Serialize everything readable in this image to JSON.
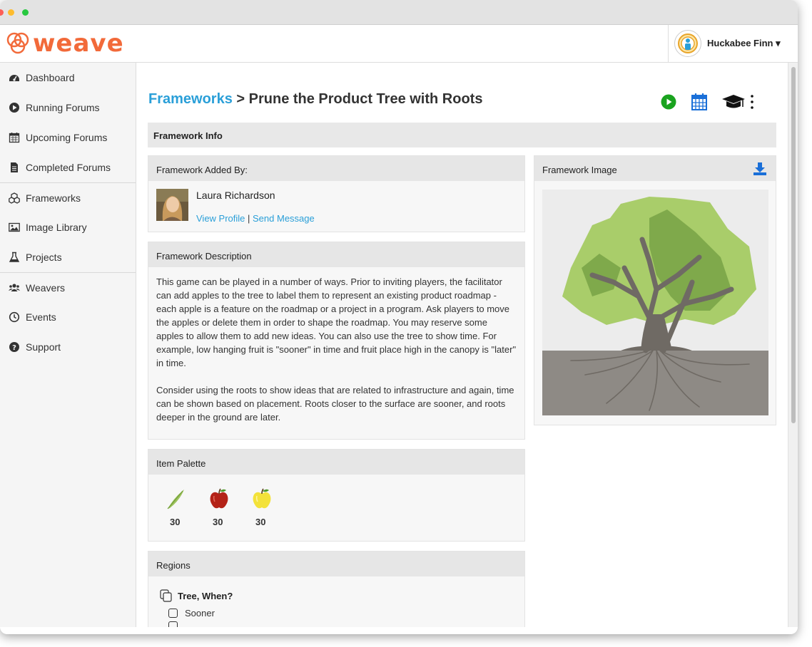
{
  "app": {
    "logo_text": "weave"
  },
  "user": {
    "name": "Huckabee Finn ▾"
  },
  "sidebar": {
    "items": [
      {
        "label": "Dashboard",
        "icon": "dashboard-icon"
      },
      {
        "label": "Running Forums",
        "icon": "play-circle-icon"
      },
      {
        "label": "Upcoming Forums",
        "icon": "calendar-icon"
      },
      {
        "label": "Completed Forums",
        "icon": "document-icon"
      },
      {
        "label": "Frameworks",
        "icon": "cubes-icon"
      },
      {
        "label": "Image Library",
        "icon": "image-icon"
      },
      {
        "label": "Projects",
        "icon": "flask-icon"
      },
      {
        "label": "Weavers",
        "icon": "users-icon"
      },
      {
        "label": "Events",
        "icon": "clock-icon"
      },
      {
        "label": "Support",
        "icon": "question-circle-icon"
      }
    ]
  },
  "page": {
    "breadcrumb": "Frameworks",
    "separator": " > ",
    "title": "Prune the Product Tree with Roots"
  },
  "framework_info": {
    "heading": "Framework Info"
  },
  "added_by": {
    "heading": "Framework Added By:",
    "name": "Laura Richardson",
    "view_profile": "View Profile",
    "divider": " | ",
    "send_message": "Send Message"
  },
  "description": {
    "heading": "Framework Description",
    "paragraph1": "This game can be played in a number of ways. Prior to inviting players, the facilitator can add apples to the tree to label them to represent an existing product roadmap - each apple is a feature on the roadmap or a project in a program. Ask players to move the apples or delete them in order to shape the roadmap. You may reserve some apples to allow them to add new ideas. You can also use the tree to show time. For example, low hanging fruit is \"sooner\" in time and fruit place high in the canopy is \"later\" in time.",
    "paragraph2": "Consider using the roots to show ideas that are related to infrastructure and again, time can be shown based on placement. Roots closer to the surface are sooner, and roots deeper in the ground are later."
  },
  "palette": {
    "heading": "Item Palette",
    "items": [
      {
        "icon": "leaf-icon",
        "count": "30"
      },
      {
        "icon": "red-apple-icon",
        "count": "30"
      },
      {
        "icon": "yellow-apple-icon",
        "count": "30"
      }
    ]
  },
  "regions": {
    "heading": "Regions",
    "group": "Tree, When?",
    "options": [
      "Sooner"
    ]
  },
  "image_card": {
    "heading": "Framework Image"
  },
  "colors": {
    "accent": "#2a9fd8",
    "brand": "#f26a3a",
    "play": "#1aa31f",
    "calendar": "#1a6fd8"
  }
}
